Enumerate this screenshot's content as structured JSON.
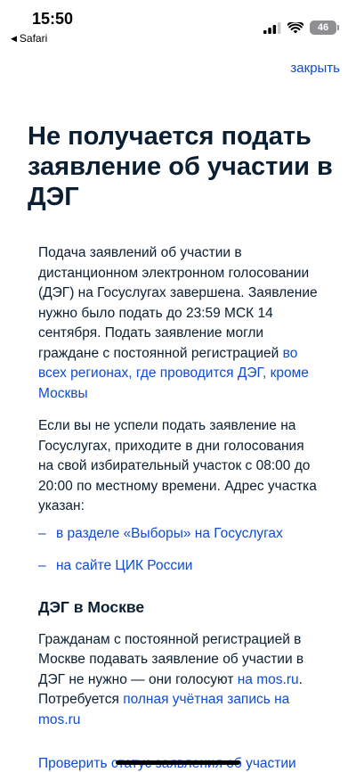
{
  "status_bar": {
    "time": "15:50",
    "back_app": "Safari",
    "battery": "46",
    "icons": [
      "signal-icon",
      "wifi-icon",
      "battery-icon"
    ]
  },
  "header": {
    "close_label": "закрыть"
  },
  "title": "Не получается подать заявление об участии в ДЭГ",
  "para1": {
    "text": "Подача заявлений об участии в дистанционном электронном голосовании (ДЭГ) на Госуслугах завершена. Заявление нужно было подать до 23:59 МСК 14 сентября. Подать заявление могли граждане с постоянной регистрацией ",
    "link": "во всех регионах, где проводится ДЭГ, кроме Москвы"
  },
  "para2": "Если вы не успели подать заявление на Госуслугах, приходите в дни голосования на свой избирательный участок с 08:00 до 20:00 по местному времени. Адрес участка указан:",
  "links": [
    {
      "dash": "–",
      "label": "в разделе «Выборы» на Госуслугах"
    },
    {
      "dash": "–",
      "label": "на сайте ЦИК России"
    }
  ],
  "moscow": {
    "heading": "ДЭГ в Москве",
    "text1": "Гражданам с постоянной регистрацией в Москве подавать заявление об участии в ДЭГ не нужно — они голосуют ",
    "link1": "на mos.ru",
    "text2": ". Потребуется ",
    "link2": "полная учётная запись на mos.ru"
  },
  "bottom_link": "Проверить статус заявления об участии",
  "colors": {
    "link": "#0d4cd3",
    "text": "#0b1f33",
    "background": "#ffffff"
  }
}
